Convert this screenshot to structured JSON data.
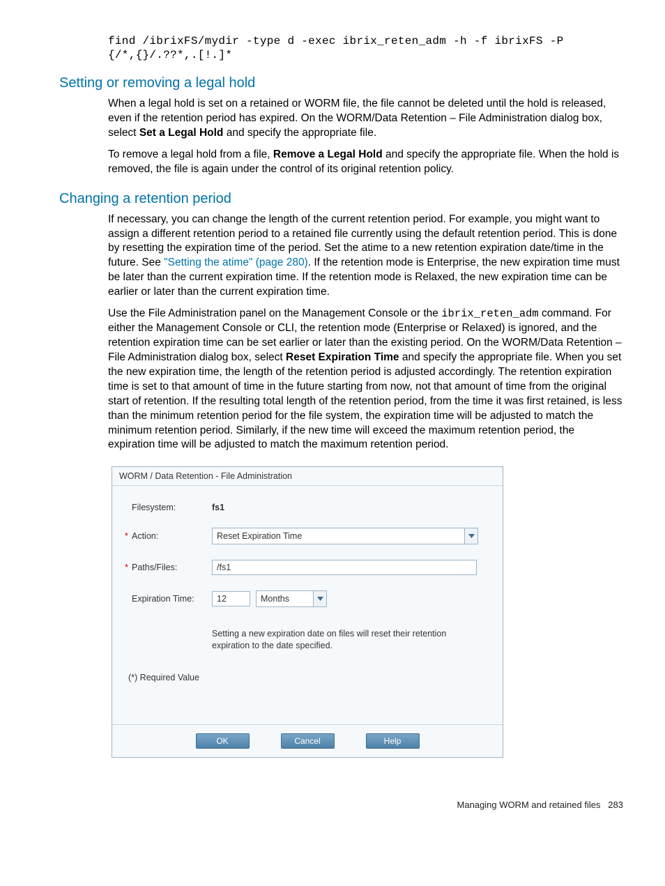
{
  "code": {
    "line1": "find /ibrixFS/mydir -type d -exec ibrix_reten_adm -h -f ibrixFS -P",
    "line2": "{/*,{}/.??*,.[!.]*"
  },
  "section1": {
    "title": "Setting or removing a legal hold",
    "p1a": "When a legal hold is set on a retained or WORM file, the file cannot be deleted until the hold is released, even if the retention period has expired. On the WORM/Data Retention – File Administration dialog box, select ",
    "p1b": "Set a Legal Hold",
    "p1c": " and specify the appropriate file.",
    "p2a": "To remove a legal hold from a file, ",
    "p2b": "Remove a Legal Hold",
    "p2c": " and specify the appropriate file. When the hold is removed, the file is again under the control of its original retention policy."
  },
  "section2": {
    "title": "Changing a retention period",
    "p1a": "If necessary, you can change the length of the current retention period. For example, you might want to assign a different retention period to a retained file currently using the default retention period. This is done by resetting the expiration time of the period. Set the atime to a new retention expiration date/time in the future. See ",
    "p1link": "\"Setting the atime\" (page 280)",
    "p1b": ". If the retention mode is Enterprise, the new expiration time must be later than the current expiration time. If the retention mode is Relaxed, the new expiration time can be earlier or later than the current expiration time.",
    "p2a": "Use the File Administration panel on the Management Console or the ",
    "p2cmd": "ibrix_reten_adm",
    "p2b": " command. For either the Management Console or CLI, the retention mode (Enterprise or Relaxed) is ignored, and the retention expiration time can be set earlier or later than the existing period. On the WORM/Data Retention – File Administration dialog box, select ",
    "p2c": "Reset Expiration Time",
    "p2d": " and specify the appropriate file. When you set the new expiration time, the length of the retention period is adjusted accordingly. The retention expiration time is set to that amount of time in the future starting from now, not that amount of time from the original start of retention. If the resulting total length of the retention period, from the time it was first retained, is less than the minimum retention period for the file system, the expiration time will be adjusted to match the minimum retention period. Similarly, if the new time will exceed the maximum retention period, the expiration time will be adjusted to match the maximum retention period."
  },
  "dialog": {
    "title": "WORM / Data Retention - File Administration",
    "labels": {
      "filesystem": "Filesystem:",
      "action": "Action:",
      "paths": "Paths/Files:",
      "expiration": "Expiration Time:"
    },
    "values": {
      "filesystem": "fs1",
      "action": "Reset Expiration Time",
      "paths": "/fs1",
      "expiration_num": "12",
      "expiration_unit": "Months"
    },
    "help": "Setting a new expiration date on files will reset their retention expiration to the date specified.",
    "required_note": "(*) Required Value",
    "buttons": {
      "ok": "OK",
      "cancel": "Cancel",
      "help": "Help"
    }
  },
  "footer": {
    "text": "Managing WORM and retained files",
    "page": "283"
  }
}
